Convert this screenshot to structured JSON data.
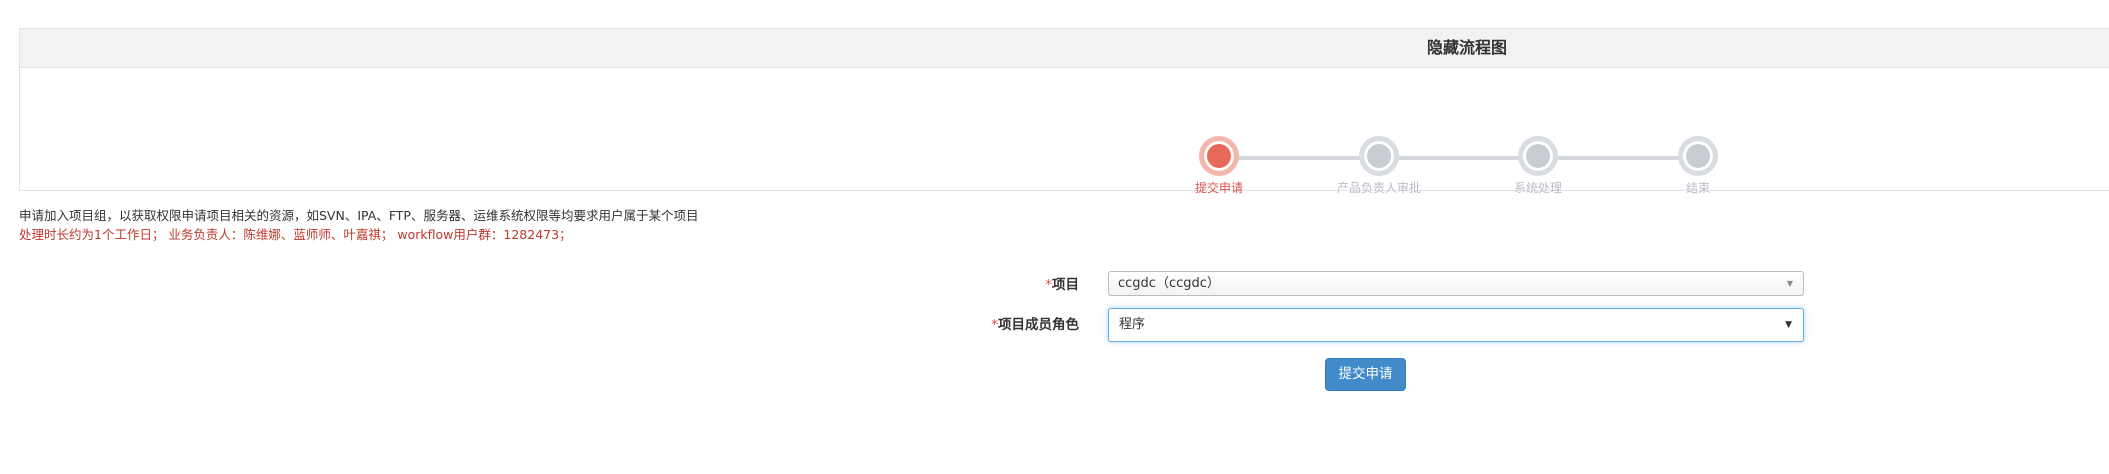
{
  "flow": {
    "title": "隐藏流程图",
    "steps": [
      {
        "label": "提交申请",
        "active": true
      },
      {
        "label": "产品负责人审批",
        "active": false
      },
      {
        "label": "系统处理",
        "active": false
      },
      {
        "label": "结束",
        "active": false
      }
    ]
  },
  "description": {
    "line1": "申请加入项目组，以获取权限申请项目相关的资源，如SVN、IPA、FTP、服务器、运维系统权限等均要求用户属于某个项目",
    "line2": "处理时长约为1个工作日；  业务负责人：陈维娜、蓝师师、叶嘉祺；  workflow用户群：1282473；"
  },
  "form": {
    "required_mark": "*",
    "project_label": "项目",
    "project_value": "ccgdc（ccgdc）",
    "role_label": "项目成员角色",
    "role_value": "程序",
    "submit_label": "提交申请"
  },
  "icons": {
    "project_caret": "caret-down-icon",
    "role_caret": "caret-down-icon"
  },
  "colors": {
    "active_step": "#e8685a",
    "inactive_step": "#c8ccd3",
    "accent_blue": "#428bca",
    "warning_text": "#c0392b"
  }
}
